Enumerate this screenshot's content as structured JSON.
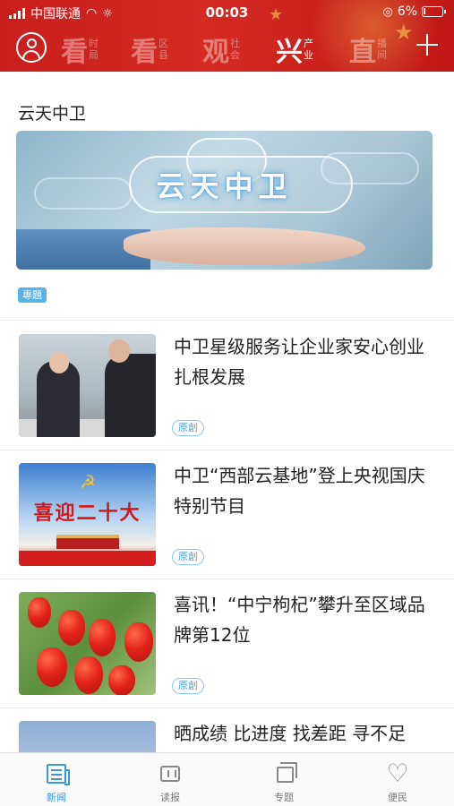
{
  "status_bar": {
    "carrier": "中国联通",
    "time": "00:03",
    "battery": "6%"
  },
  "nav": {
    "tabs": [
      {
        "big": "看",
        "small1": "时",
        "small2": "局",
        "active": false
      },
      {
        "big": "看",
        "small1": "区",
        "small2": "县",
        "active": false
      },
      {
        "big": "观",
        "small1": "社",
        "small2": "会",
        "active": false
      },
      {
        "big": "兴",
        "small1": "产",
        "small2": "业",
        "active": true
      },
      {
        "big": "直",
        "small1": "播",
        "small2": "间",
        "active": false
      }
    ]
  },
  "feature": {
    "section_title": "云天中卫",
    "banner_text": "云天中卫",
    "tag": "專題"
  },
  "news": [
    {
      "title": "中卫星级服务让企业家安心创业扎根发展",
      "tag": "原創"
    },
    {
      "title": "中卫“西部云基地”登上央视国庆特别节目",
      "tag": "原創",
      "thumb_text": "喜迎二十大"
    },
    {
      "title": "喜讯！“中宁枸杞”攀升至区域品牌第12位",
      "tag": "原創"
    },
    {
      "title": "晒成绩 比进度 找差距 寻不足",
      "tag": ""
    }
  ],
  "tabbar": {
    "items": [
      {
        "label": "新闻",
        "icon": "news-icon",
        "active": true
      },
      {
        "label": "读报",
        "icon": "newspaper-icon",
        "active": false
      },
      {
        "label": "专题",
        "icon": "topic-icon",
        "active": false
      },
      {
        "label": "便民",
        "icon": "heart-icon",
        "active": false
      }
    ]
  },
  "colors": {
    "header_red": "#c81e1e",
    "accent_blue": "#3d95d8",
    "tag_blue": "#5bb2e6"
  }
}
